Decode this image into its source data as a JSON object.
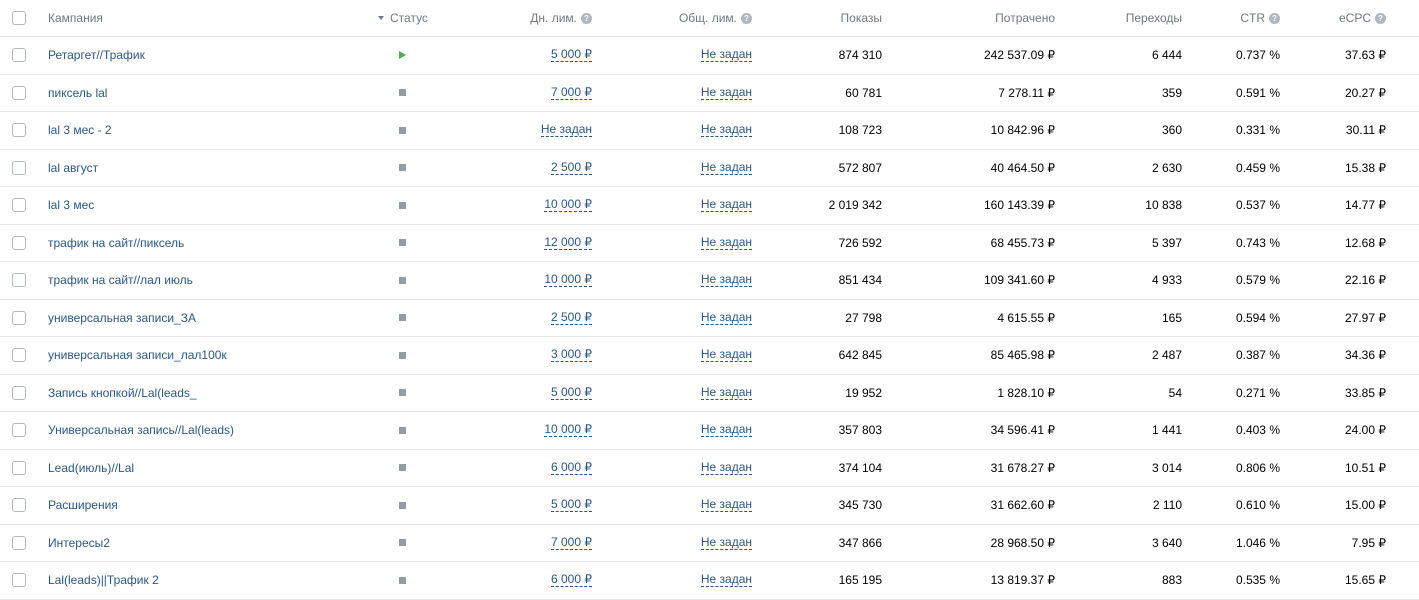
{
  "header": {
    "campaign": "Кампания",
    "status": "Статус",
    "daily_limit": "Дн. лим.",
    "total_limit": "Общ. лим.",
    "impressions": "Показы",
    "spent": "Потрачено",
    "transitions": "Переходы",
    "ctr": "CTR",
    "ecpc": "eCPC"
  },
  "rows": [
    {
      "name": "Ретаргет//Трафик",
      "status": "running",
      "daily": "5 000 ₽",
      "total": "Не задан",
      "impressions": "874 310",
      "spent": "242 537.09 ₽",
      "transitions": "6 444",
      "ctr": "0.737 %",
      "ecpc": "37.63 ₽"
    },
    {
      "name": "пиксель lal",
      "status": "stopped",
      "daily": "7 000 ₽",
      "total": "Не задан",
      "impressions": "60 781",
      "spent": "7 278.11 ₽",
      "transitions": "359",
      "ctr": "0.591 %",
      "ecpc": "20.27 ₽"
    },
    {
      "name": "lal 3 мес - 2",
      "status": "stopped",
      "daily": "Не задан",
      "total": "Не задан",
      "impressions": "108 723",
      "spent": "10 842.96 ₽",
      "transitions": "360",
      "ctr": "0.331 %",
      "ecpc": "30.11 ₽"
    },
    {
      "name": "lal август",
      "status": "stopped",
      "daily": "2 500 ₽",
      "total": "Не задан",
      "impressions": "572 807",
      "spent": "40 464.50 ₽",
      "transitions": "2 630",
      "ctr": "0.459 %",
      "ecpc": "15.38 ₽"
    },
    {
      "name": "lal 3 мес",
      "status": "stopped",
      "daily": "10 000 ₽",
      "total": "Не задан",
      "impressions": "2 019 342",
      "spent": "160 143.39 ₽",
      "transitions": "10 838",
      "ctr": "0.537 %",
      "ecpc": "14.77 ₽"
    },
    {
      "name": "трафик на сайт//пиксель",
      "status": "stopped",
      "daily": "12 000 ₽",
      "total": "Не задан",
      "impressions": "726 592",
      "spent": "68 455.73 ₽",
      "transitions": "5 397",
      "ctr": "0.743 %",
      "ecpc": "12.68 ₽"
    },
    {
      "name": "трафик на сайт//лал июль",
      "status": "stopped",
      "daily": "10 000 ₽",
      "total": "Не задан",
      "impressions": "851 434",
      "spent": "109 341.60 ₽",
      "transitions": "4 933",
      "ctr": "0.579 %",
      "ecpc": "22.16 ₽"
    },
    {
      "name": "универсальная записи_ЗА",
      "status": "stopped",
      "daily": "2 500 ₽",
      "total": "Не задан",
      "impressions": "27 798",
      "spent": "4 615.55 ₽",
      "transitions": "165",
      "ctr": "0.594 %",
      "ecpc": "27.97 ₽"
    },
    {
      "name": "универсальная записи_лал100к",
      "status": "stopped",
      "daily": "3 000 ₽",
      "total": "Не задан",
      "impressions": "642 845",
      "spent": "85 465.98 ₽",
      "transitions": "2 487",
      "ctr": "0.387 %",
      "ecpc": "34.36 ₽"
    },
    {
      "name": "Запись кнопкой//Lal(leads_",
      "status": "stopped",
      "daily": "5 000 ₽",
      "total": "Не задан",
      "impressions": "19 952",
      "spent": "1 828.10 ₽",
      "transitions": "54",
      "ctr": "0.271 %",
      "ecpc": "33.85 ₽"
    },
    {
      "name": "Универсальная запись//Lal(leads)",
      "status": "stopped",
      "daily": "10 000 ₽",
      "total": "Не задан",
      "impressions": "357 803",
      "spent": "34 596.41 ₽",
      "transitions": "1 441",
      "ctr": "0.403 %",
      "ecpc": "24.00 ₽"
    },
    {
      "name": "Lead(июль)//Lal",
      "status": "stopped",
      "daily": "6 000 ₽",
      "total": "Не задан",
      "impressions": "374 104",
      "spent": "31 678.27 ₽",
      "transitions": "3 014",
      "ctr": "0.806 %",
      "ecpc": "10.51 ₽"
    },
    {
      "name": "Расширения",
      "status": "stopped",
      "daily": "5 000 ₽",
      "total": "Не задан",
      "impressions": "345 730",
      "spent": "31 662.60 ₽",
      "transitions": "2 110",
      "ctr": "0.610 %",
      "ecpc": "15.00 ₽"
    },
    {
      "name": "Интересы2",
      "status": "stopped",
      "daily": "7 000 ₽",
      "total": "Не задан",
      "impressions": "347 866",
      "spent": "28 968.50 ₽",
      "transitions": "3 640",
      "ctr": "1.046 %",
      "ecpc": "7.95 ₽"
    },
    {
      "name": "Lal(leads)||Трафик 2",
      "status": "stopped",
      "daily": "6 000 ₽",
      "total": "Не задан",
      "impressions": "165 195",
      "spent": "13 819.37 ₽",
      "transitions": "883",
      "ctr": "0.535 %",
      "ecpc": "15.65 ₽"
    }
  ],
  "colors": {
    "link": "#2a5885",
    "header_text": "#6f7985",
    "running": "#4bb34b",
    "stopped": "#939ba4",
    "divider": "#e7e8ec"
  },
  "icons": {
    "help": "question-circle-icon",
    "sort": "sort-desc-icon",
    "running": "play-icon",
    "stopped": "stop-icon"
  },
  "help_glyph": "?"
}
